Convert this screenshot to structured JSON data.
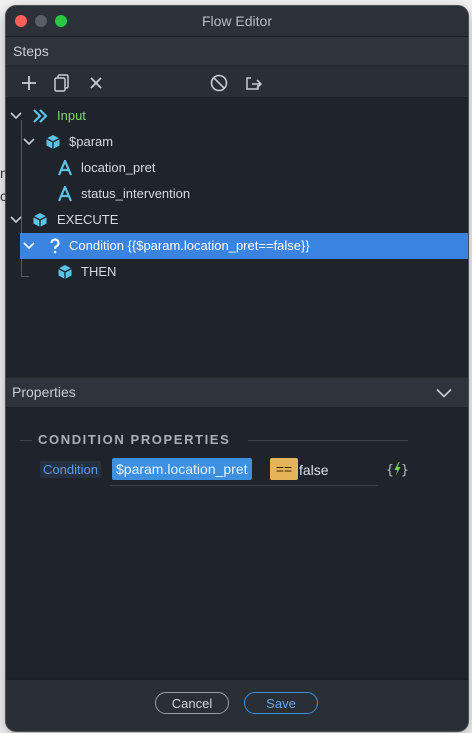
{
  "window": {
    "title": "Flow Editor"
  },
  "steps": {
    "header": "Steps",
    "toolbar": [
      "add-icon",
      "duplicate-icon",
      "delete-icon",
      "disable-icon",
      "export-icon"
    ],
    "tree": [
      {
        "label": "Input",
        "icon": "input-chevrons-icon"
      },
      {
        "label": "$param",
        "icon": "cube-icon"
      },
      {
        "label": "location_pret",
        "icon": "text-type-icon"
      },
      {
        "label": "status_intervention",
        "icon": "text-type-icon"
      },
      {
        "label": "EXECUTE",
        "icon": "cube-icon"
      },
      {
        "label": "Condition {{$param.location_pret==false}}",
        "icon": "question-icon",
        "selected": true
      },
      {
        "label": "THEN",
        "icon": "cube-icon"
      }
    ]
  },
  "properties": {
    "header": "Properties",
    "section_title": "CONDITION PROPERTIES",
    "condition_label": "Condition",
    "expression": {
      "param": "$param.location_pret",
      "operator": "==",
      "value": "false"
    },
    "expr_icon": "{ϟ}"
  },
  "footer": {
    "cancel": "Cancel",
    "save": "Save"
  },
  "colors": {
    "accent": "#3a83e0",
    "green": "#86d36a",
    "operator": "#e5b35a",
    "cube": "#5cc3e6"
  }
}
